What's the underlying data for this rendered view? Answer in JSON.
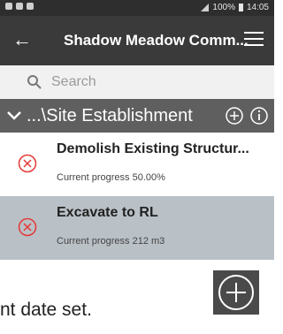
{
  "status_bar": {
    "battery": "100%",
    "time": "14:05"
  },
  "header": {
    "title": "Shadow Meadow Comm..."
  },
  "search": {
    "placeholder": "Search"
  },
  "folder": {
    "label": "...\\Site Establishment"
  },
  "tasks": [
    {
      "name": "Demolish Existing Structur...",
      "progress": "Current progress 50.00%"
    },
    {
      "name": "Excavate to RL",
      "progress": "Current progress 212 m3"
    }
  ],
  "footer": {
    "text": "nt date set."
  },
  "colors": {
    "app_bar": "#3a3a3a",
    "folder_row": "#5f5f5f",
    "selected_row": "#b9c0c6",
    "status_red": "#e53935"
  }
}
